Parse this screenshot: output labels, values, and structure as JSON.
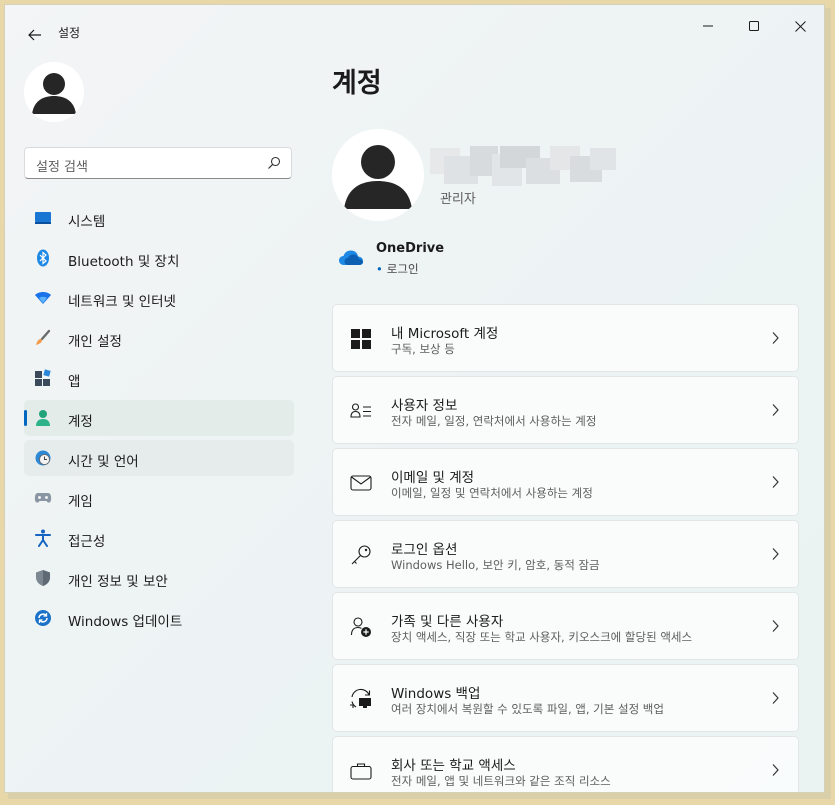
{
  "window": {
    "title": "설정"
  },
  "search": {
    "placeholder": "설정 검색"
  },
  "sidebar": {
    "items": [
      {
        "label": "시스템",
        "icon": "system-monitor-icon"
      },
      {
        "label": "Bluetooth 및 장치",
        "icon": "bluetooth-icon"
      },
      {
        "label": "네트워크 및 인터넷",
        "icon": "wifi-icon"
      },
      {
        "label": "개인 설정",
        "icon": "brush-icon"
      },
      {
        "label": "앱",
        "icon": "apps-icon"
      },
      {
        "label": "계정",
        "icon": "person-icon",
        "selected": true
      },
      {
        "label": "시간 및 언어",
        "icon": "globe-clock-icon"
      },
      {
        "label": "게임",
        "icon": "gamepad-icon"
      },
      {
        "label": "접근성",
        "icon": "accessibility-icon"
      },
      {
        "label": "개인 정보 및 보안",
        "icon": "shield-icon"
      },
      {
        "label": "Windows 업데이트",
        "icon": "update-icon"
      }
    ]
  },
  "main": {
    "title": "계정",
    "profile": {
      "role": "관리자"
    },
    "onedrive": {
      "title": "OneDrive",
      "status": "로그인"
    },
    "cards": [
      {
        "title": "내 Microsoft 계정",
        "subtitle": "구독, 보상 등",
        "icon": "windows-logo-icon"
      },
      {
        "title": "사용자 정보",
        "subtitle": "전자 메일, 일정, 연락처에서 사용하는 계정",
        "icon": "person-info-icon"
      },
      {
        "title": "이메일 및 계정",
        "subtitle": "이메일, 일정 및 연락처에서 사용하는 계정",
        "icon": "mail-icon"
      },
      {
        "title": "로그인 옵션",
        "subtitle": "Windows Hello, 보안 키, 암호, 동적 잠금",
        "icon": "key-icon"
      },
      {
        "title": "가족 및 다른 사용자",
        "subtitle": "장치 액세스, 직장 또는 학교 사용자, 키오스크에 할당된 액세스",
        "icon": "family-add-icon"
      },
      {
        "title": "Windows 백업",
        "subtitle": "여러 장치에서 복원할 수 있도록 파일, 앱, 기본 설정 백업",
        "icon": "backup-icon"
      },
      {
        "title": "회사 또는 학교 액세스",
        "subtitle": "전자 메일, 앱 및 네트워크와 같은 조직 리소스",
        "icon": "briefcase-icon"
      }
    ]
  },
  "colors": {
    "accent": "#0067c0",
    "selected_bg": "#e4ecea"
  }
}
